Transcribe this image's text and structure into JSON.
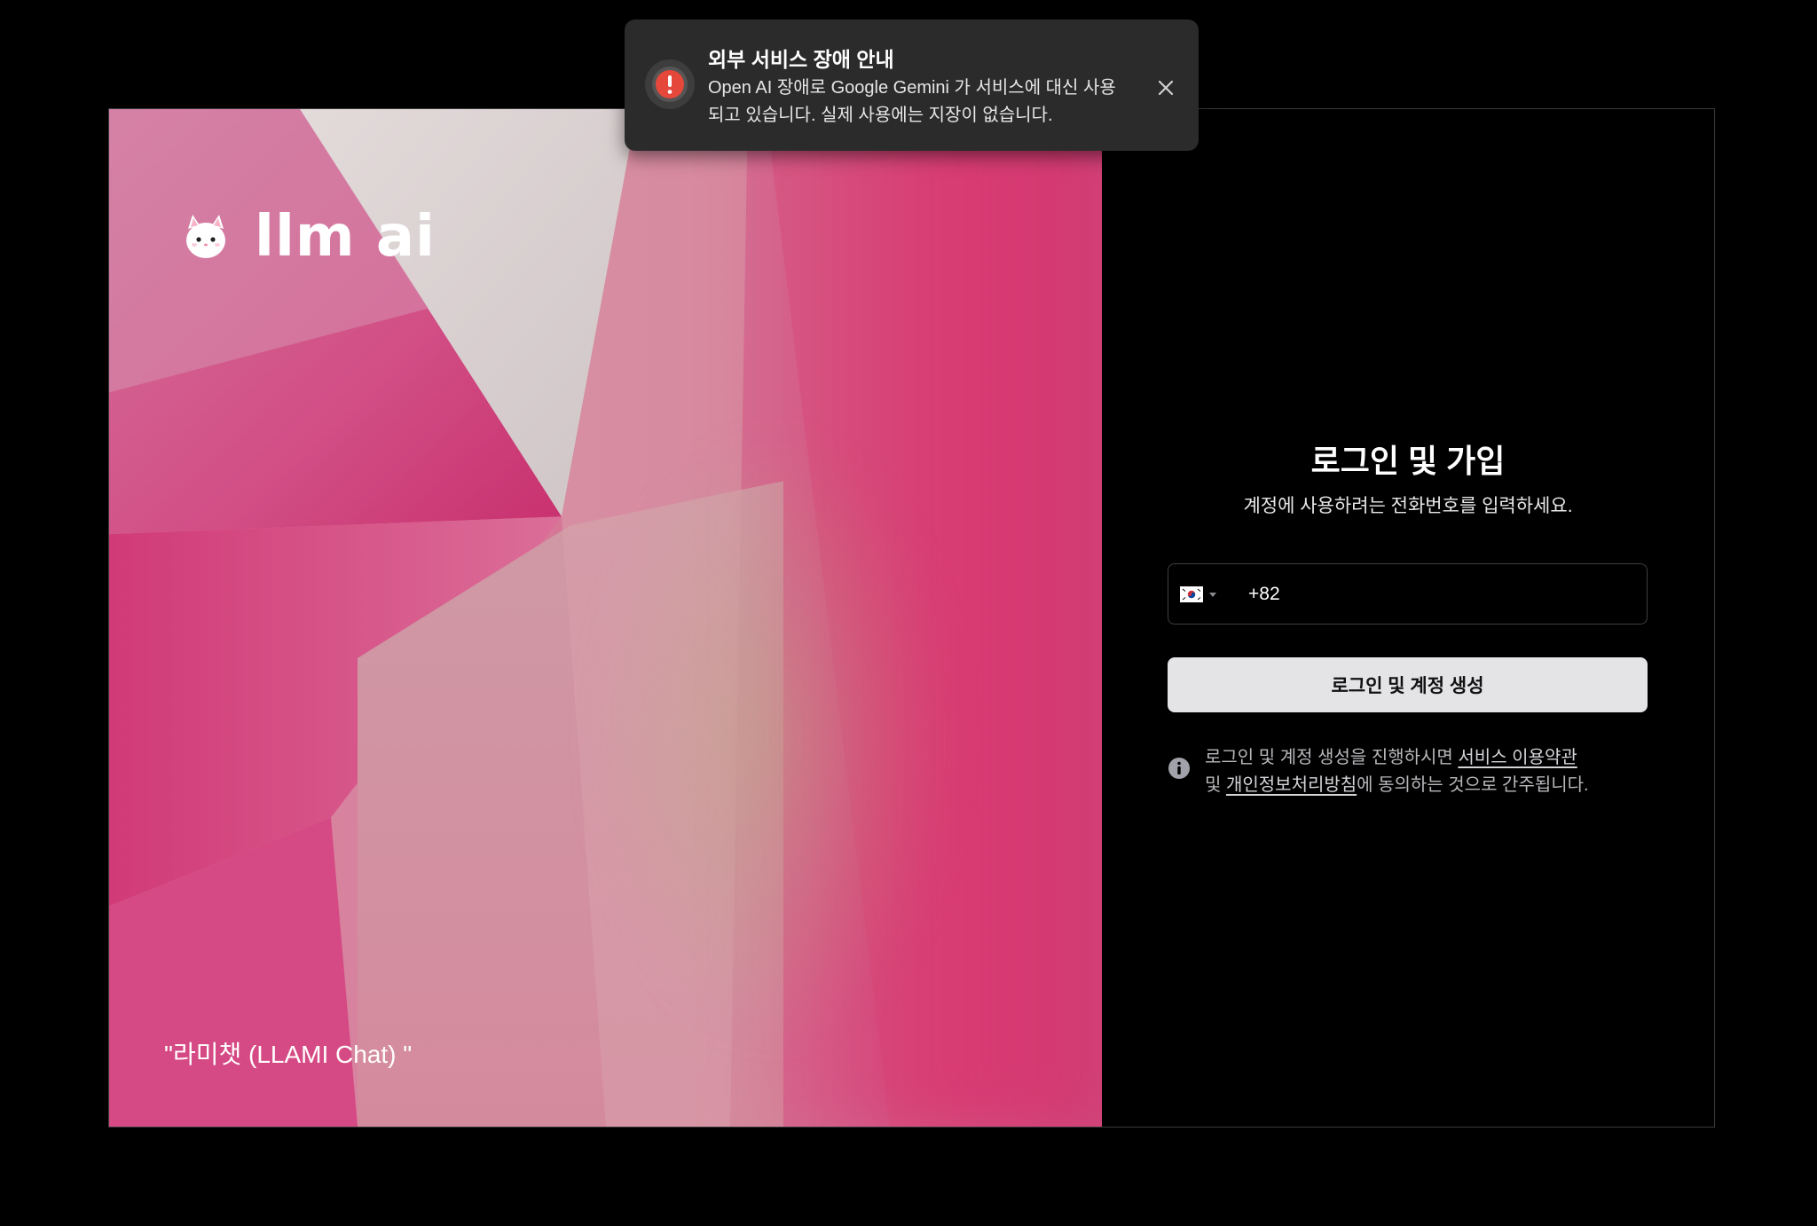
{
  "toast": {
    "title": "외부 서비스 장애 안내",
    "message": "Open AI 장애로 Google Gemini 가 서비스에 대신 사용되고 있습니다. 실제 사용에는 지장이 없습니다.",
    "icon": "alert-circle-icon",
    "close_icon": "close-icon",
    "accent_color": "#e5483b"
  },
  "brand": {
    "wordmark": "llm ai",
    "mascot_icon": "cat-mascot-icon"
  },
  "art": {
    "caption": "\"라미챗 (LLAMI Chat) \""
  },
  "login": {
    "title": "로그인 및 가입",
    "subtitle": "계정에 사용하려는 전화번호를 입력하세요.",
    "country_flag_icon": "korea-flag-icon",
    "phone_value": "+82",
    "submit_label": "로그인 및 계정 생성",
    "notice_prefix": "로그인 및 계정 생성을 진행하시면 ",
    "terms_link": "서비스 이용약관",
    "notice_middle": "및 ",
    "privacy_link": "개인정보처리방침",
    "notice_suffix": "에 동의하는 것으로 간주됩니다.",
    "info_icon": "info-icon"
  }
}
